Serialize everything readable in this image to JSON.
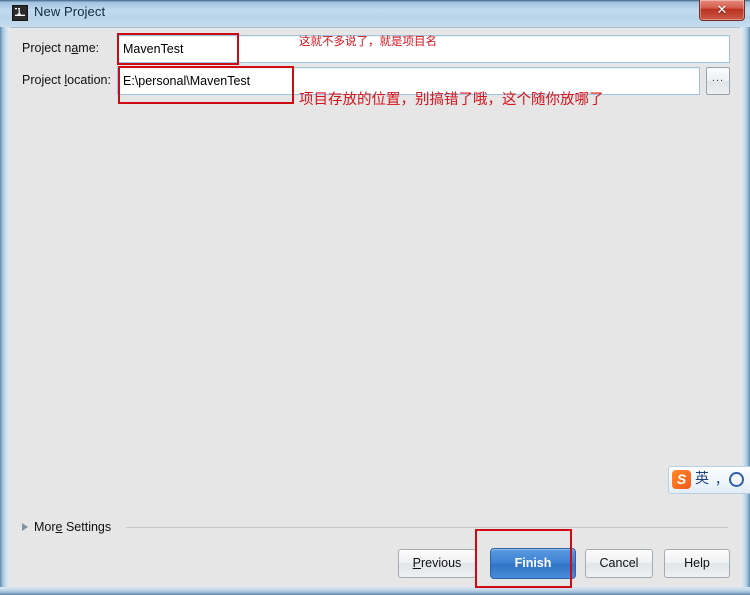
{
  "window": {
    "title": "New Project",
    "app_icon": "intellij-idea-icon",
    "close_label": "✕"
  },
  "form": {
    "name_label_before": "Project n",
    "name_label_mnemonic": "a",
    "name_label_after": "me:",
    "name_value": "MavenTest",
    "location_label_before": "Project ",
    "location_label_mnemonic": "l",
    "location_label_after": "ocation:",
    "location_value": "E:\\personal\\MavenTest",
    "browse_label": "..."
  },
  "annotations": [
    {
      "id": "project-name-note",
      "text": "这就不多说了，就是项目名",
      "color": "#d6121b"
    },
    {
      "id": "project-location-note",
      "text": "项目存放的位置，别搞错了哦，这个随你放哪了",
      "color": "#d6121b"
    }
  ],
  "more_settings": {
    "label_before": "Mor",
    "label_mnemonic": "e",
    "label_after": " Settings",
    "expanded": false,
    "arrow_icon": "triangle-right-icon"
  },
  "buttons": {
    "previous_before": "",
    "previous_mnemonic": "P",
    "previous_after": "revious",
    "finish": "Finish",
    "cancel": "Cancel",
    "help": "Help"
  },
  "ime": {
    "brand": "S",
    "mode": "英",
    "punctuation": "，",
    "shape": "○"
  },
  "colors": {
    "annotation_red": "#d6121b",
    "highlight_box_red": "#cf0a12",
    "finish_blue": "#3d82d4",
    "dialog_bg": "#e6e6e6",
    "title_glass": "#c2daee",
    "field_border": "#9ec4e0"
  }
}
